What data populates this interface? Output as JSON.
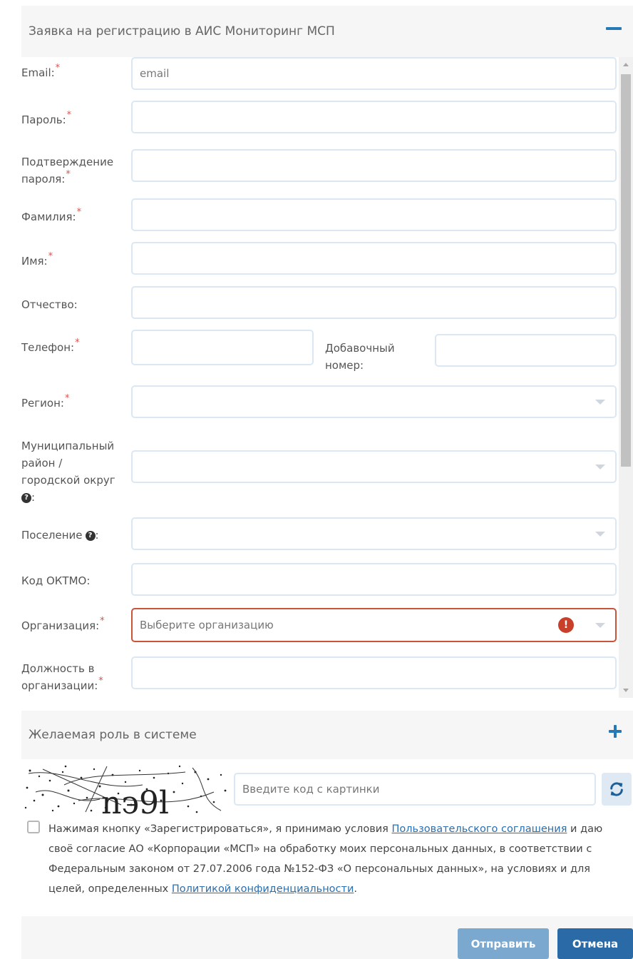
{
  "form": {
    "title": "Заявка на регистрацию в АИС Мониторинг МСП",
    "required_mark": "*",
    "fields": {
      "email": {
        "label": "Email:",
        "placeholder": "email"
      },
      "password": {
        "label": "Пароль:"
      },
      "confirm": {
        "label_line1": "Подтверждение",
        "label_line2": "пароля:"
      },
      "lastname": {
        "label": "Фамилия:"
      },
      "firstname": {
        "label": "Имя:"
      },
      "patronymic": {
        "label": "Отчество:"
      },
      "phone": {
        "label": "Телефон:"
      },
      "ext": {
        "label_line1": "Добавочный",
        "label_line2": "номер:"
      },
      "region": {
        "label": "Регион:"
      },
      "municipal": {
        "label_line1": "Муниципальный",
        "label_line2": "район /",
        "label_line3": "городской округ",
        "label_suffix": ":"
      },
      "settlement": {
        "label": "Поселение",
        "label_suffix": ":"
      },
      "oktmo": {
        "label": "Код ОКТМО:"
      },
      "organization": {
        "label": "Организация:",
        "placeholder": "Выберите организацию"
      },
      "position": {
        "label_line1": "Должность в",
        "label_line2": "организации:"
      }
    }
  },
  "role_panel": {
    "title": "Желаемая роль в системе"
  },
  "captcha": {
    "placeholder": "Введите код с картинки"
  },
  "consent": {
    "text1": "Нажимая кнопку «Зарегистрироваться», я принимаю условия ",
    "link1": "Пользовательского соглашения",
    "text2": " и даю своё согласие АО «Корпорации «МСП» на обработку моих персональных данных, в соответствии с Федеральным законом от 27.07.2006 года №152-ФЗ «О персональных данных», на условиях и для целей, определенных ",
    "link2": "Политикой конфиденциальности",
    "text3": "."
  },
  "buttons": {
    "submit": "Отправить",
    "cancel": "Отмена"
  },
  "colors": {
    "accent": "#2679b5",
    "error": "#c8543a",
    "required": "#d9534f",
    "submit_bg": "#7ba8cf",
    "cancel_bg": "#2a6aa6"
  },
  "icons": {
    "collapse": "minus-icon",
    "expand": "plus-icon",
    "refresh": "refresh-icon",
    "error": "exclamation-icon",
    "help": "question-icon",
    "dropdown": "chevron-down-icon"
  }
}
